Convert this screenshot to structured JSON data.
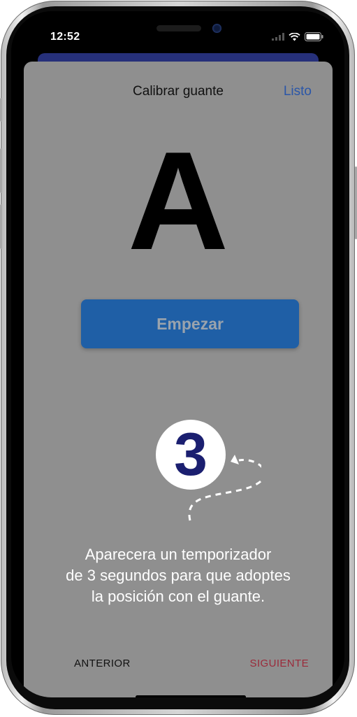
{
  "status_bar": {
    "time": "12:52"
  },
  "sheet": {
    "title": "Calibrar guante",
    "done_label": "Listo",
    "letter": "A",
    "start_label": "Empezar",
    "countdown": "3",
    "instruction_lines": [
      "Aparecera un temporizador",
      "de 3 segundos para que adoptes",
      "la posición con el guante."
    ],
    "prev_label": "ANTERIOR",
    "next_label": "SIGUIENTE"
  },
  "colors": {
    "sheet_bg": "#8f8f8f",
    "accent": "#1f5fa6",
    "link": "#2a56a8",
    "next": "#9b2a3a",
    "countdown": "#1b1f70"
  },
  "icons": [
    "signal-icon",
    "wifi-icon",
    "battery-icon",
    "dashed-arrow-icon"
  ]
}
